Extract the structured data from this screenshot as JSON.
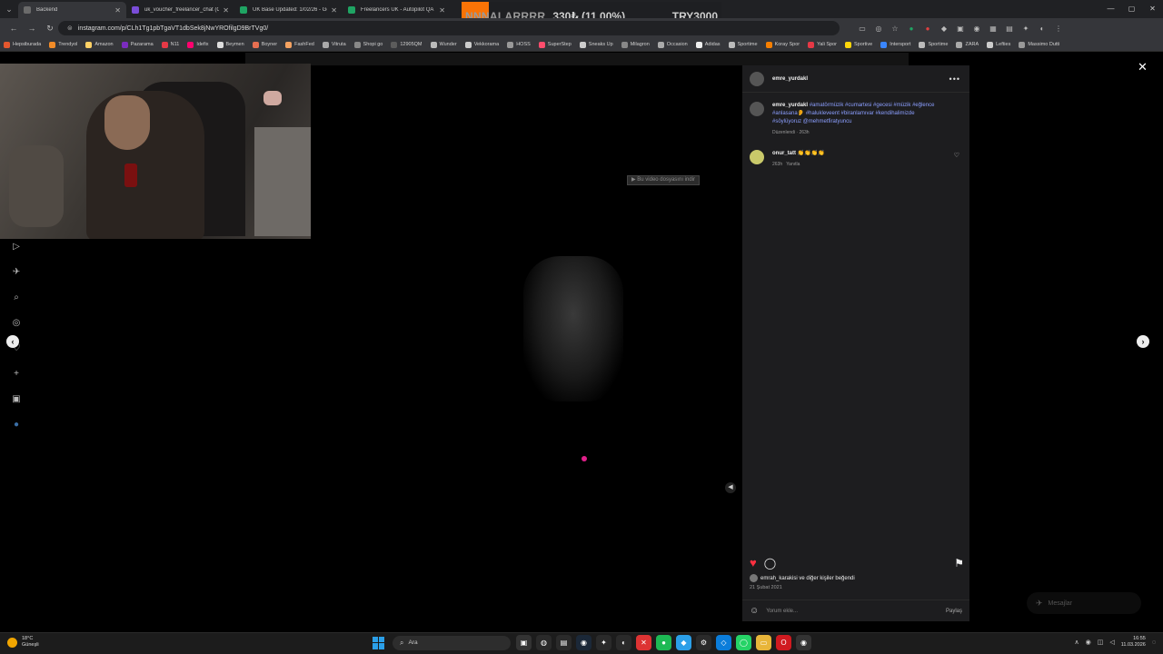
{
  "browser": {
    "tabs": [
      {
        "title": "Backend",
        "color": "#6b6b6b"
      },
      {
        "title": "uk_voucher_freelancer_chat (C",
        "color": "#7a4dd8"
      },
      {
        "title": "UK Base Updated: 1/02/26 - Go",
        "color": "#1fa463"
      },
      {
        "title": "Freelancers UK - Autopilot QA",
        "color": "#1fa463"
      }
    ],
    "url": "instagram.com/p/CLh1Tg1pbTgaVT1dbSek8jNwYROfilgD9BrTVg0/",
    "bookmarks": [
      "Hepsiburada",
      "Trendyol",
      "Amazon",
      "Pazarama",
      "N11",
      "Idefix",
      "Beymen",
      "Boyner",
      "FashFed",
      "Vitruta",
      "Shopi go",
      "12905QM",
      "Wunder",
      "Vekkorama",
      "HOSS",
      "SuperStep",
      "Sneaks Up",
      "Milagron",
      "Occasion",
      "Adidas",
      "Sportime",
      "Koray Spor",
      "Yali Spor",
      "Sportive",
      "Intersport",
      "Sportime",
      "ZARA",
      "Lefties",
      "Massimo Dutti"
    ]
  },
  "ticker": {
    "name": "NNNALARRRR",
    "pct": "330₺ (11.00%)",
    "amount": "TRY3000"
  },
  "video": {
    "download_tip": "Bu video dosyasını indir"
  },
  "post": {
    "username": "emre_yurdakl",
    "caption_user": "emre_yurdakl",
    "caption_tags": "#amatörmüzik #cumartesi #gecesi #müzik #eğlence #anlasana👂 #halukleveent #biranlamıvar #kendihalimizde #söylüyoruz @mehmetfiratyuncu",
    "edited_meta": "Düzenlendi · 263h",
    "comment_user": "onur_tatt",
    "comment_text": "👏👏👏👏",
    "comment_meta_time": "263h",
    "comment_meta_reply": "Yanıtla",
    "likes_text": "emrah_karakisi ve diğer kişiler beğendi",
    "likes_user": "emrah_karakisi",
    "likes_rest": "ve",
    "likes_others": "diğer kişiler",
    "likes_end": "beğendi",
    "date": "21 Şubat 2021",
    "comment_placeholder": "Yorum ekle...",
    "share_label": "Paylaş"
  },
  "messages_label": "Mesajlar",
  "taskbar": {
    "weather_temp": "18°C",
    "weather_desc": "Güneşli",
    "search_label": "Ara",
    "time": "16:55",
    "date": "11.03.2026"
  },
  "colors": {
    "accent_orange": "#f97306",
    "like_red": "#ff3040",
    "hashtag_blue": "#8c9fff"
  }
}
